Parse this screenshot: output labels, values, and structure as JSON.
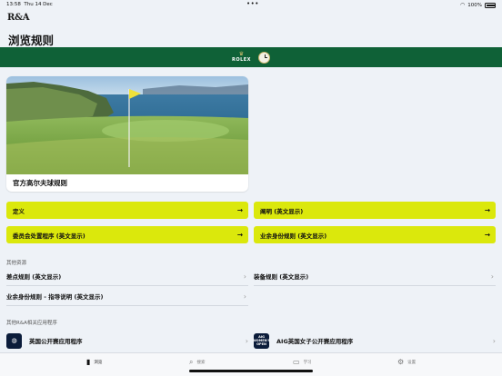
{
  "status_bar": {
    "time": "13:58",
    "date": "Thu 14 Dec",
    "dots": "•••",
    "battery": "100%"
  },
  "header": {
    "logo": "R&A",
    "title": "浏览规则"
  },
  "banner": {
    "brand": "ROLEX",
    "crown_icon": "crown-icon",
    "clock_icon": "clock-icon",
    "color": "#0f6137"
  },
  "hero": {
    "caption": "官方高尔夫球规则"
  },
  "buttons": [
    {
      "label": "定义",
      "arrow": "→"
    },
    {
      "label": "阐明 (英文显示)",
      "arrow": "→"
    },
    {
      "label": "委员会处置程序 (英文显示)",
      "arrow": "→"
    },
    {
      "label": "业余身份规则 (英文显示)",
      "arrow": "→"
    }
  ],
  "other_resources": {
    "heading": "其他资源",
    "items": [
      {
        "label": "差点规则 (英文显示)",
        "chevron": "›"
      },
      {
        "label": "装备规则 (英文显示)",
        "chevron": "›"
      },
      {
        "label": "业余身份规则 - 指导说明 (英文显示)",
        "chevron": "›"
      }
    ]
  },
  "other_apps": {
    "heading": "其他R&A相关应用程序",
    "items": [
      {
        "label": "英国公开赛应用程序",
        "icon": "open-championship-icon",
        "chevron": "›"
      },
      {
        "label": "AIG英国女子公开赛应用程序",
        "icon": "aig-womens-open-icon",
        "icon_text": "AIG WOMEN'S OPEN",
        "chevron": "›"
      }
    ]
  },
  "tabs": [
    {
      "label": "浏览",
      "icon": "book-icon",
      "active": true
    },
    {
      "label": "搜索",
      "icon": "search-icon",
      "active": false
    },
    {
      "label": "学习",
      "icon": "video-icon",
      "active": false
    },
    {
      "label": "设置",
      "icon": "gear-icon",
      "active": false
    }
  ],
  "colors": {
    "accent_yellow": "#dbe80c",
    "banner_green": "#0f6137",
    "background": "#eef2f7"
  }
}
